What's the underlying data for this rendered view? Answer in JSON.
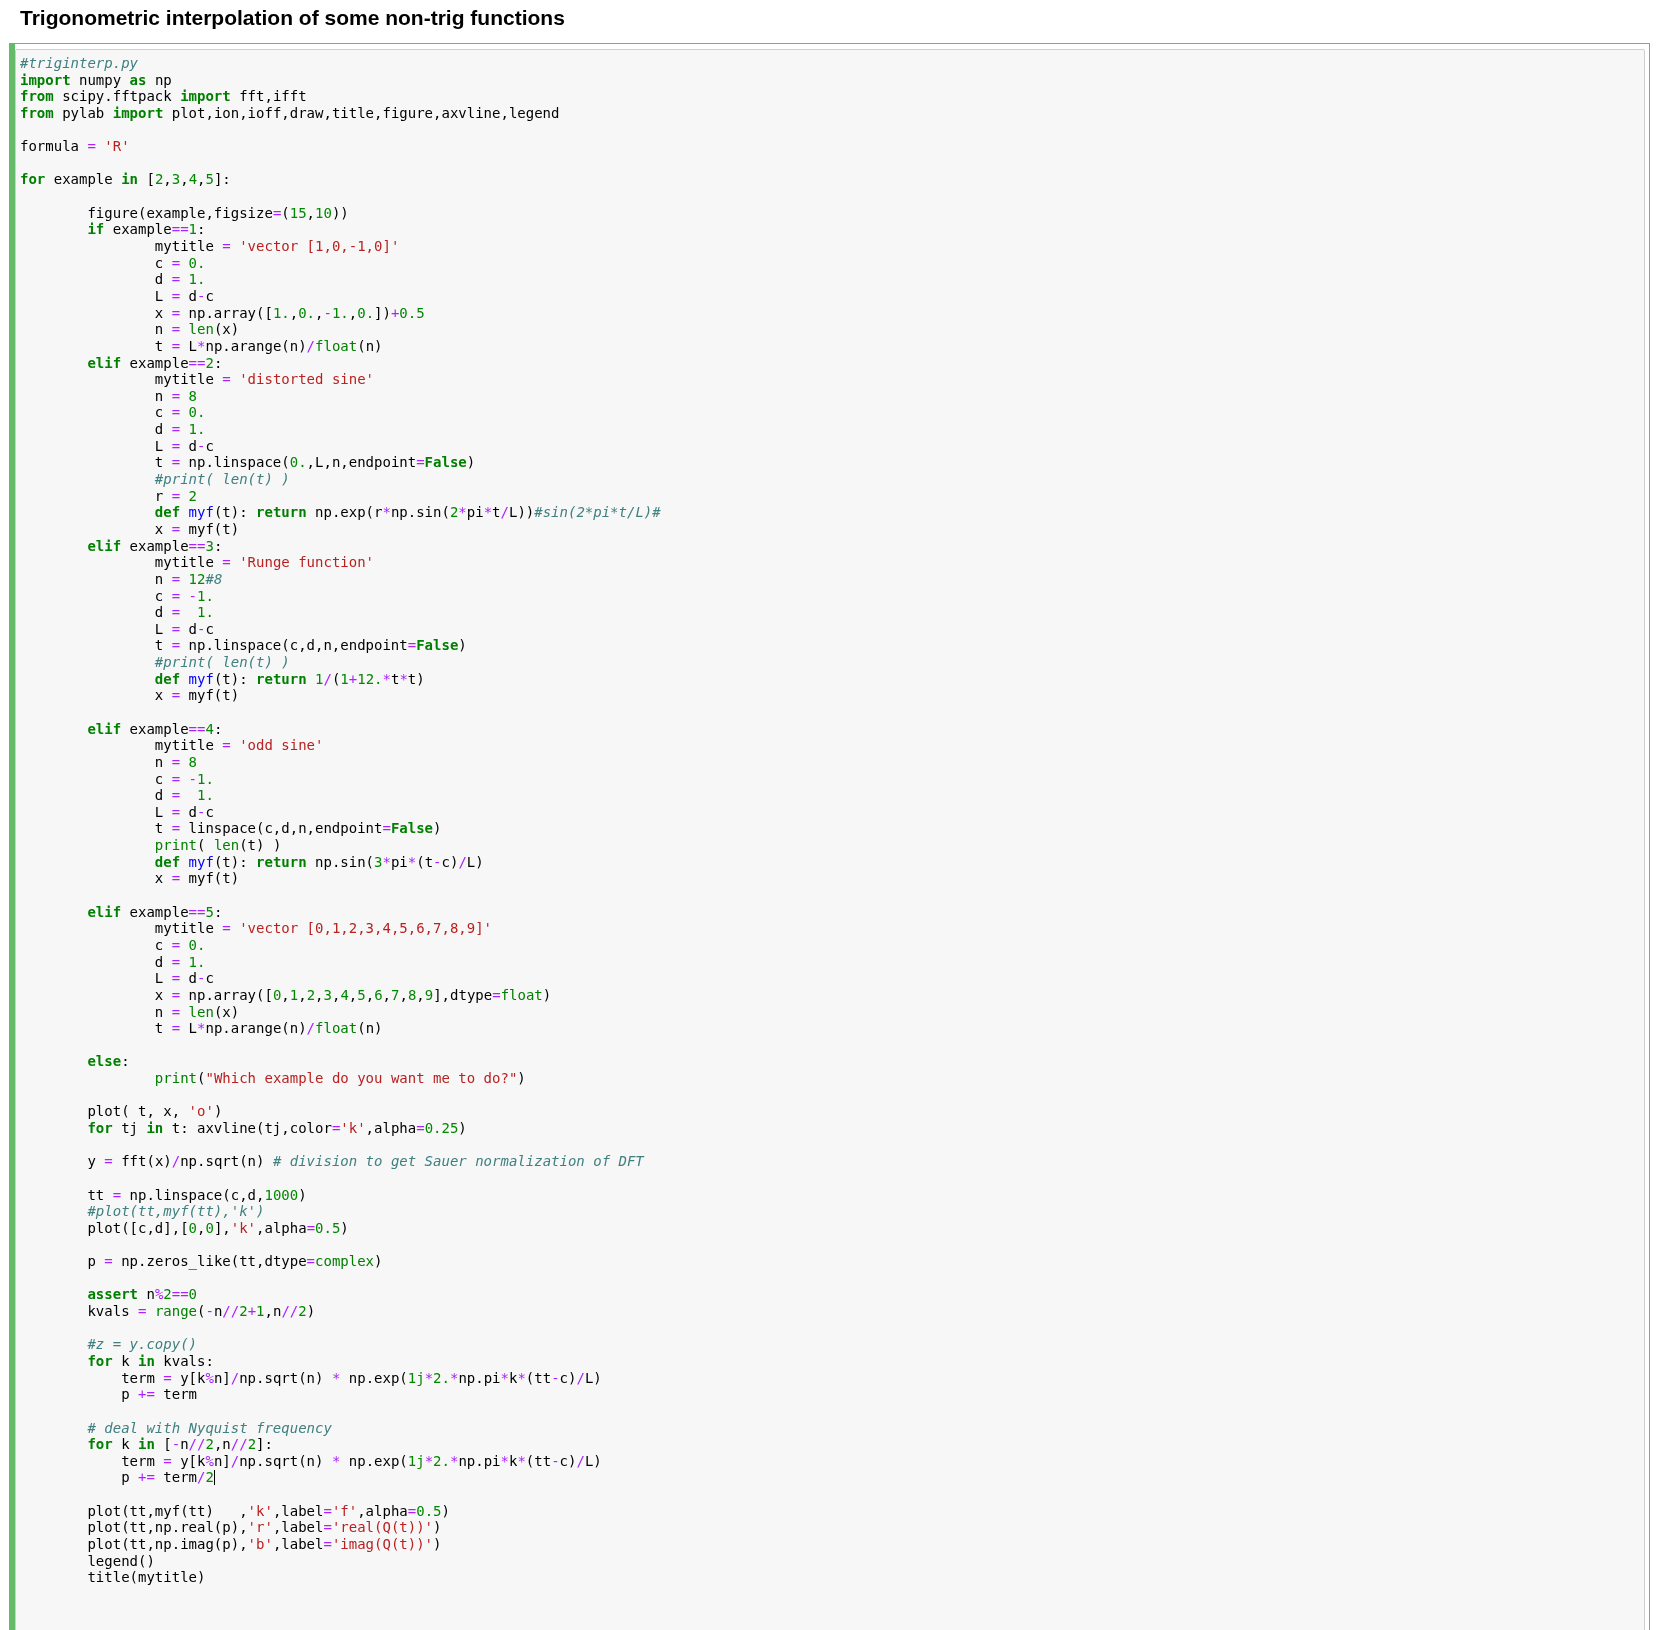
{
  "title": "Trigonometric interpolation of some non-trig functions",
  "code_lines": [
    {
      "tokens": [
        {
          "kind": "c",
          "text": "#triginterp.py"
        }
      ]
    },
    {
      "tokens": [
        {
          "kind": "k",
          "text": "import"
        },
        {
          "kind": "p",
          "text": " numpy "
        },
        {
          "kind": "k",
          "text": "as"
        },
        {
          "kind": "p",
          "text": " np"
        }
      ]
    },
    {
      "tokens": [
        {
          "kind": "k",
          "text": "from"
        },
        {
          "kind": "p",
          "text": " scipy.fftpack "
        },
        {
          "kind": "k",
          "text": "import"
        },
        {
          "kind": "p",
          "text": " fft,ifft"
        }
      ]
    },
    {
      "tokens": [
        {
          "kind": "k",
          "text": "from"
        },
        {
          "kind": "p",
          "text": " pylab "
        },
        {
          "kind": "k",
          "text": "import"
        },
        {
          "kind": "p",
          "text": " plot,ion,ioff,draw,title,figure,axvline,legend"
        }
      ]
    },
    {
      "gap": true,
      "tokens": [
        {
          "kind": "p",
          "text": "formula "
        },
        {
          "kind": "o",
          "text": "="
        },
        {
          "kind": "s",
          "text": " 'R'"
        }
      ]
    },
    {
      "gap": true,
      "tokens": [
        {
          "kind": "k",
          "text": "for"
        },
        {
          "kind": "p",
          "text": " example "
        },
        {
          "kind": "k",
          "text": "in"
        },
        {
          "kind": "p",
          "text": " ["
        },
        {
          "kind": "n",
          "text": "2"
        },
        {
          "kind": "p",
          "text": ","
        },
        {
          "kind": "n",
          "text": "3"
        },
        {
          "kind": "p",
          "text": ","
        },
        {
          "kind": "n",
          "text": "4"
        },
        {
          "kind": "p",
          "text": ","
        },
        {
          "kind": "n",
          "text": "5"
        },
        {
          "kind": "p",
          "text": "]:"
        }
      ]
    },
    {
      "gap": true,
      "tokens": [
        {
          "kind": "p",
          "text": "        figure(example,figsize"
        },
        {
          "kind": "o",
          "text": "="
        },
        {
          "kind": "p",
          "text": "("
        },
        {
          "kind": "n",
          "text": "15"
        },
        {
          "kind": "p",
          "text": ","
        },
        {
          "kind": "n",
          "text": "10"
        },
        {
          "kind": "p",
          "text": "))"
        }
      ]
    },
    {
      "tokens": [
        {
          "kind": "k",
          "text": "        if"
        },
        {
          "kind": "p",
          "text": " example"
        },
        {
          "kind": "o",
          "text": "=="
        },
        {
          "kind": "n",
          "text": "1"
        },
        {
          "kind": "p",
          "text": ":"
        }
      ]
    },
    {
      "tokens": [
        {
          "kind": "p",
          "text": "                mytitle "
        },
        {
          "kind": "o",
          "text": "="
        },
        {
          "kind": "s",
          "text": " 'vector [1,0,-1,0]'"
        }
      ]
    },
    {
      "tokens": [
        {
          "kind": "p",
          "text": "                c "
        },
        {
          "kind": "o",
          "text": "="
        },
        {
          "kind": "n",
          "text": " 0."
        }
      ]
    },
    {
      "tokens": [
        {
          "kind": "p",
          "text": "                d "
        },
        {
          "kind": "o",
          "text": "="
        },
        {
          "kind": "n",
          "text": " 1."
        }
      ]
    },
    {
      "tokens": [
        {
          "kind": "p",
          "text": "                L "
        },
        {
          "kind": "o",
          "text": "="
        },
        {
          "kind": "p",
          "text": " d"
        },
        {
          "kind": "o",
          "text": "-"
        },
        {
          "kind": "p",
          "text": "c"
        }
      ]
    },
    {
      "tokens": [
        {
          "kind": "p",
          "text": "                x "
        },
        {
          "kind": "o",
          "text": "="
        },
        {
          "kind": "p",
          "text": " np.array(["
        },
        {
          "kind": "n",
          "text": "1."
        },
        {
          "kind": "p",
          "text": ","
        },
        {
          "kind": "n",
          "text": "0."
        },
        {
          "kind": "p",
          "text": ","
        },
        {
          "kind": "o",
          "text": "-"
        },
        {
          "kind": "n",
          "text": "1."
        },
        {
          "kind": "p",
          "text": ","
        },
        {
          "kind": "n",
          "text": "0."
        },
        {
          "kind": "p",
          "text": "])"
        },
        {
          "kind": "o",
          "text": "+"
        },
        {
          "kind": "n",
          "text": "0.5"
        }
      ]
    },
    {
      "tokens": [
        {
          "kind": "p",
          "text": "                n "
        },
        {
          "kind": "o",
          "text": "="
        },
        {
          "kind": "b",
          "text": " len"
        },
        {
          "kind": "p",
          "text": "(x)"
        }
      ]
    },
    {
      "tokens": [
        {
          "kind": "p",
          "text": "                t "
        },
        {
          "kind": "o",
          "text": "="
        },
        {
          "kind": "p",
          "text": " L"
        },
        {
          "kind": "o",
          "text": "*"
        },
        {
          "kind": "p",
          "text": "np.arange(n)"
        },
        {
          "kind": "o",
          "text": "/"
        },
        {
          "kind": "b",
          "text": "float"
        },
        {
          "kind": "p",
          "text": "(n)"
        }
      ]
    },
    {
      "tokens": [
        {
          "kind": "k",
          "text": "        elif"
        },
        {
          "kind": "p",
          "text": " example"
        },
        {
          "kind": "o",
          "text": "=="
        },
        {
          "kind": "n",
          "text": "2"
        },
        {
          "kind": "p",
          "text": ":"
        }
      ]
    },
    {
      "tokens": [
        {
          "kind": "p",
          "text": "                mytitle "
        },
        {
          "kind": "o",
          "text": "="
        },
        {
          "kind": "s",
          "text": " 'distorted sine'"
        }
      ]
    },
    {
      "tokens": [
        {
          "kind": "p",
          "text": "                n "
        },
        {
          "kind": "o",
          "text": "="
        },
        {
          "kind": "n",
          "text": " 8"
        }
      ]
    },
    {
      "tokens": [
        {
          "kind": "p",
          "text": "                c "
        },
        {
          "kind": "o",
          "text": "="
        },
        {
          "kind": "n",
          "text": " 0."
        }
      ]
    },
    {
      "tokens": [
        {
          "kind": "p",
          "text": "                d "
        },
        {
          "kind": "o",
          "text": "="
        },
        {
          "kind": "n",
          "text": " 1."
        }
      ]
    },
    {
      "tokens": [
        {
          "kind": "p",
          "text": "                L "
        },
        {
          "kind": "o",
          "text": "="
        },
        {
          "kind": "p",
          "text": " d"
        },
        {
          "kind": "o",
          "text": "-"
        },
        {
          "kind": "p",
          "text": "c"
        }
      ]
    },
    {
      "tokens": [
        {
          "kind": "p",
          "text": "                t "
        },
        {
          "kind": "o",
          "text": "="
        },
        {
          "kind": "p",
          "text": " np.linspace("
        },
        {
          "kind": "n",
          "text": "0."
        },
        {
          "kind": "p",
          "text": ",L,n,endpoint"
        },
        {
          "kind": "o",
          "text": "="
        },
        {
          "kind": "k",
          "text": "False"
        },
        {
          "kind": "p",
          "text": ")"
        }
      ]
    },
    {
      "tokens": [
        {
          "kind": "c",
          "text": "                #print( len(t) )"
        }
      ]
    },
    {
      "tokens": [
        {
          "kind": "p",
          "text": "                r "
        },
        {
          "kind": "o",
          "text": "="
        },
        {
          "kind": "n",
          "text": " 2"
        }
      ]
    },
    {
      "tokens": [
        {
          "kind": "k",
          "text": "                def"
        },
        {
          "kind": "f",
          "text": " myf"
        },
        {
          "kind": "p",
          "text": "(t): "
        },
        {
          "kind": "k",
          "text": "return"
        },
        {
          "kind": "p",
          "text": " np.exp(r"
        },
        {
          "kind": "o",
          "text": "*"
        },
        {
          "kind": "p",
          "text": "np.sin("
        },
        {
          "kind": "n",
          "text": "2"
        },
        {
          "kind": "o",
          "text": "*"
        },
        {
          "kind": "p",
          "text": "pi"
        },
        {
          "kind": "o",
          "text": "*"
        },
        {
          "kind": "p",
          "text": "t"
        },
        {
          "kind": "o",
          "text": "/"
        },
        {
          "kind": "p",
          "text": "L))"
        },
        {
          "kind": "c",
          "text": "#sin(2*pi*t/L)#"
        }
      ]
    },
    {
      "tokens": [
        {
          "kind": "p",
          "text": "                x "
        },
        {
          "kind": "o",
          "text": "="
        },
        {
          "kind": "p",
          "text": " myf(t)"
        }
      ]
    },
    {
      "tokens": [
        {
          "kind": "k",
          "text": "        elif"
        },
        {
          "kind": "p",
          "text": " example"
        },
        {
          "kind": "o",
          "text": "=="
        },
        {
          "kind": "n",
          "text": "3"
        },
        {
          "kind": "p",
          "text": ":"
        }
      ]
    },
    {
      "tokens": [
        {
          "kind": "p",
          "text": "                mytitle "
        },
        {
          "kind": "o",
          "text": "="
        },
        {
          "kind": "s",
          "text": " 'Runge function'"
        }
      ]
    },
    {
      "tokens": [
        {
          "kind": "p",
          "text": "                n "
        },
        {
          "kind": "o",
          "text": "="
        },
        {
          "kind": "n",
          "text": " 12"
        },
        {
          "kind": "c",
          "text": "#8"
        }
      ]
    },
    {
      "tokens": [
        {
          "kind": "p",
          "text": "                c "
        },
        {
          "kind": "o",
          "text": "= -"
        },
        {
          "kind": "n",
          "text": "1."
        }
      ]
    },
    {
      "tokens": [
        {
          "kind": "p",
          "text": "                d "
        },
        {
          "kind": "o",
          "text": "="
        },
        {
          "kind": "n",
          "text": "  1."
        }
      ]
    },
    {
      "tokens": [
        {
          "kind": "p",
          "text": "                L "
        },
        {
          "kind": "o",
          "text": "="
        },
        {
          "kind": "p",
          "text": " d"
        },
        {
          "kind": "o",
          "text": "-"
        },
        {
          "kind": "p",
          "text": "c"
        }
      ]
    },
    {
      "tokens": [
        {
          "kind": "p",
          "text": "                t "
        },
        {
          "kind": "o",
          "text": "="
        },
        {
          "kind": "p",
          "text": " np.linspace(c,d,n,endpoint"
        },
        {
          "kind": "o",
          "text": "="
        },
        {
          "kind": "k",
          "text": "False"
        },
        {
          "kind": "p",
          "text": ")"
        }
      ]
    },
    {
      "tokens": [
        {
          "kind": "c",
          "text": "                #print( len(t) )"
        }
      ]
    },
    {
      "tokens": [
        {
          "kind": "k",
          "text": "                def"
        },
        {
          "kind": "f",
          "text": " myf"
        },
        {
          "kind": "p",
          "text": "(t): "
        },
        {
          "kind": "k",
          "text": "return"
        },
        {
          "kind": "n",
          "text": " 1"
        },
        {
          "kind": "o",
          "text": "/"
        },
        {
          "kind": "p",
          "text": "("
        },
        {
          "kind": "n",
          "text": "1"
        },
        {
          "kind": "o",
          "text": "+"
        },
        {
          "kind": "n",
          "text": "12."
        },
        {
          "kind": "o",
          "text": "*"
        },
        {
          "kind": "p",
          "text": "t"
        },
        {
          "kind": "o",
          "text": "*"
        },
        {
          "kind": "p",
          "text": "t)"
        }
      ]
    },
    {
      "tokens": [
        {
          "kind": "p",
          "text": "                x "
        },
        {
          "kind": "o",
          "text": "="
        },
        {
          "kind": "p",
          "text": " myf(t)"
        }
      ]
    },
    {
      "gap": true,
      "tokens": [
        {
          "kind": "k",
          "text": "        elif"
        },
        {
          "kind": "p",
          "text": " example"
        },
        {
          "kind": "o",
          "text": "=="
        },
        {
          "kind": "n",
          "text": "4"
        },
        {
          "kind": "p",
          "text": ":"
        }
      ]
    },
    {
      "tokens": [
        {
          "kind": "p",
          "text": "                mytitle "
        },
        {
          "kind": "o",
          "text": "="
        },
        {
          "kind": "s",
          "text": " 'odd sine'"
        }
      ]
    },
    {
      "tokens": [
        {
          "kind": "p",
          "text": "                n "
        },
        {
          "kind": "o",
          "text": "="
        },
        {
          "kind": "n",
          "text": " 8"
        }
      ]
    },
    {
      "tokens": [
        {
          "kind": "p",
          "text": "                c "
        },
        {
          "kind": "o",
          "text": "= -"
        },
        {
          "kind": "n",
          "text": "1."
        }
      ]
    },
    {
      "tokens": [
        {
          "kind": "p",
          "text": "                d "
        },
        {
          "kind": "o",
          "text": "="
        },
        {
          "kind": "n",
          "text": "  1."
        }
      ]
    },
    {
      "tokens": [
        {
          "kind": "p",
          "text": "                L "
        },
        {
          "kind": "o",
          "text": "="
        },
        {
          "kind": "p",
          "text": " d"
        },
        {
          "kind": "o",
          "text": "-"
        },
        {
          "kind": "p",
          "text": "c"
        }
      ]
    },
    {
      "tokens": [
        {
          "kind": "p",
          "text": "                t "
        },
        {
          "kind": "o",
          "text": "="
        },
        {
          "kind": "p",
          "text": " linspace(c,d,n,endpoint"
        },
        {
          "kind": "o",
          "text": "="
        },
        {
          "kind": "k",
          "text": "False"
        },
        {
          "kind": "p",
          "text": ")"
        }
      ]
    },
    {
      "tokens": [
        {
          "kind": "b",
          "text": "                print"
        },
        {
          "kind": "p",
          "text": "( "
        },
        {
          "kind": "b",
          "text": "len"
        },
        {
          "kind": "p",
          "text": "(t) )"
        }
      ]
    },
    {
      "tokens": [
        {
          "kind": "k",
          "text": "                def"
        },
        {
          "kind": "f",
          "text": " myf"
        },
        {
          "kind": "p",
          "text": "(t): "
        },
        {
          "kind": "k",
          "text": "return"
        },
        {
          "kind": "p",
          "text": " np.sin("
        },
        {
          "kind": "n",
          "text": "3"
        },
        {
          "kind": "o",
          "text": "*"
        },
        {
          "kind": "p",
          "text": "pi"
        },
        {
          "kind": "o",
          "text": "*"
        },
        {
          "kind": "p",
          "text": "(t"
        },
        {
          "kind": "o",
          "text": "-"
        },
        {
          "kind": "p",
          "text": "c)"
        },
        {
          "kind": "o",
          "text": "/"
        },
        {
          "kind": "p",
          "text": "L)"
        }
      ]
    },
    {
      "tokens": [
        {
          "kind": "p",
          "text": "                x "
        },
        {
          "kind": "o",
          "text": "="
        },
        {
          "kind": "p",
          "text": " myf(t)"
        }
      ]
    },
    {
      "gap": true,
      "tokens": [
        {
          "kind": "k",
          "text": "        elif"
        },
        {
          "kind": "p",
          "text": " example"
        },
        {
          "kind": "o",
          "text": "=="
        },
        {
          "kind": "n",
          "text": "5"
        },
        {
          "kind": "p",
          "text": ":"
        }
      ]
    },
    {
      "tokens": [
        {
          "kind": "p",
          "text": "                mytitle "
        },
        {
          "kind": "o",
          "text": "="
        },
        {
          "kind": "s",
          "text": " 'vector [0,1,2,3,4,5,6,7,8,9]'"
        }
      ]
    },
    {
      "tokens": [
        {
          "kind": "p",
          "text": "                c "
        },
        {
          "kind": "o",
          "text": "="
        },
        {
          "kind": "n",
          "text": " 0."
        }
      ]
    },
    {
      "tokens": [
        {
          "kind": "p",
          "text": "                d "
        },
        {
          "kind": "o",
          "text": "="
        },
        {
          "kind": "n",
          "text": " 1."
        }
      ]
    },
    {
      "tokens": [
        {
          "kind": "p",
          "text": "                L "
        },
        {
          "kind": "o",
          "text": "="
        },
        {
          "kind": "p",
          "text": " d"
        },
        {
          "kind": "o",
          "text": "-"
        },
        {
          "kind": "p",
          "text": "c"
        }
      ]
    },
    {
      "tokens": [
        {
          "kind": "p",
          "text": "                x "
        },
        {
          "kind": "o",
          "text": "="
        },
        {
          "kind": "p",
          "text": " np.array(["
        },
        {
          "kind": "n",
          "text": "0"
        },
        {
          "kind": "p",
          "text": ","
        },
        {
          "kind": "n",
          "text": "1"
        },
        {
          "kind": "p",
          "text": ","
        },
        {
          "kind": "n",
          "text": "2"
        },
        {
          "kind": "p",
          "text": ","
        },
        {
          "kind": "n",
          "text": "3"
        },
        {
          "kind": "p",
          "text": ","
        },
        {
          "kind": "n",
          "text": "4"
        },
        {
          "kind": "p",
          "text": ","
        },
        {
          "kind": "n",
          "text": "5"
        },
        {
          "kind": "p",
          "text": ","
        },
        {
          "kind": "n",
          "text": "6"
        },
        {
          "kind": "p",
          "text": ","
        },
        {
          "kind": "n",
          "text": "7"
        },
        {
          "kind": "p",
          "text": ","
        },
        {
          "kind": "n",
          "text": "8"
        },
        {
          "kind": "p",
          "text": ","
        },
        {
          "kind": "n",
          "text": "9"
        },
        {
          "kind": "p",
          "text": "],dtype"
        },
        {
          "kind": "o",
          "text": "="
        },
        {
          "kind": "b",
          "text": "float"
        },
        {
          "kind": "p",
          "text": ")"
        }
      ]
    },
    {
      "tokens": [
        {
          "kind": "p",
          "text": "                n "
        },
        {
          "kind": "o",
          "text": "="
        },
        {
          "kind": "b",
          "text": " len"
        },
        {
          "kind": "p",
          "text": "(x)"
        }
      ]
    },
    {
      "tokens": [
        {
          "kind": "p",
          "text": "                t "
        },
        {
          "kind": "o",
          "text": "="
        },
        {
          "kind": "p",
          "text": " L"
        },
        {
          "kind": "o",
          "text": "*"
        },
        {
          "kind": "p",
          "text": "np.arange(n)"
        },
        {
          "kind": "o",
          "text": "/"
        },
        {
          "kind": "b",
          "text": "float"
        },
        {
          "kind": "p",
          "text": "(n)"
        }
      ]
    },
    {
      "gap": true,
      "tokens": [
        {
          "kind": "k",
          "text": "        else"
        },
        {
          "kind": "p",
          "text": ":"
        }
      ]
    },
    {
      "tokens": [
        {
          "kind": "b",
          "text": "                print"
        },
        {
          "kind": "p",
          "text": "("
        },
        {
          "kind": "s",
          "text": "\"Which example do you want me to do?\""
        },
        {
          "kind": "p",
          "text": ")"
        }
      ]
    },
    {
      "gap": true,
      "tokens": [
        {
          "kind": "p",
          "text": "        plot( t, x, "
        },
        {
          "kind": "s",
          "text": "'o'"
        },
        {
          "kind": "p",
          "text": ")"
        }
      ]
    },
    {
      "tokens": [
        {
          "kind": "k",
          "text": "        for"
        },
        {
          "kind": "p",
          "text": " tj "
        },
        {
          "kind": "k",
          "text": "in"
        },
        {
          "kind": "p",
          "text": " t: axvline(tj,color"
        },
        {
          "kind": "o",
          "text": "="
        },
        {
          "kind": "s",
          "text": "'k'"
        },
        {
          "kind": "p",
          "text": ",alpha"
        },
        {
          "kind": "o",
          "text": "="
        },
        {
          "kind": "n",
          "text": "0.25"
        },
        {
          "kind": "p",
          "text": ")"
        }
      ]
    },
    {
      "gap": true,
      "tokens": [
        {
          "kind": "p",
          "text": "        y "
        },
        {
          "kind": "o",
          "text": "="
        },
        {
          "kind": "p",
          "text": " fft(x)"
        },
        {
          "kind": "o",
          "text": "/"
        },
        {
          "kind": "p",
          "text": "np.sqrt(n) "
        },
        {
          "kind": "c",
          "text": "# division to get Sauer normalization of DFT"
        }
      ]
    },
    {
      "gap": true,
      "tokens": [
        {
          "kind": "p",
          "text": "        tt "
        },
        {
          "kind": "o",
          "text": "="
        },
        {
          "kind": "p",
          "text": " np.linspace(c,d,"
        },
        {
          "kind": "n",
          "text": "1000"
        },
        {
          "kind": "p",
          "text": ")"
        }
      ]
    },
    {
      "tokens": [
        {
          "kind": "c",
          "text": "        #plot(tt,myf(tt),'k')"
        }
      ]
    },
    {
      "tokens": [
        {
          "kind": "p",
          "text": "        plot([c,d],["
        },
        {
          "kind": "n",
          "text": "0"
        },
        {
          "kind": "p",
          "text": ","
        },
        {
          "kind": "n",
          "text": "0"
        },
        {
          "kind": "p",
          "text": "],"
        },
        {
          "kind": "s",
          "text": "'k'"
        },
        {
          "kind": "p",
          "text": ",alpha"
        },
        {
          "kind": "o",
          "text": "="
        },
        {
          "kind": "n",
          "text": "0.5"
        },
        {
          "kind": "p",
          "text": ")"
        }
      ]
    },
    {
      "gap": true,
      "tokens": [
        {
          "kind": "p",
          "text": "        p "
        },
        {
          "kind": "o",
          "text": "="
        },
        {
          "kind": "p",
          "text": " np.zeros_like(tt,dtype"
        },
        {
          "kind": "o",
          "text": "="
        },
        {
          "kind": "b",
          "text": "complex"
        },
        {
          "kind": "p",
          "text": ")"
        }
      ]
    },
    {
      "gap": true,
      "tokens": [
        {
          "kind": "k",
          "text": "        assert"
        },
        {
          "kind": "p",
          "text": " n"
        },
        {
          "kind": "o",
          "text": "%"
        },
        {
          "kind": "n",
          "text": "2"
        },
        {
          "kind": "o",
          "text": "=="
        },
        {
          "kind": "n",
          "text": "0"
        }
      ]
    },
    {
      "tokens": [
        {
          "kind": "p",
          "text": "        kvals "
        },
        {
          "kind": "o",
          "text": "="
        },
        {
          "kind": "b",
          "text": " range"
        },
        {
          "kind": "p",
          "text": "("
        },
        {
          "kind": "o",
          "text": "-"
        },
        {
          "kind": "p",
          "text": "n"
        },
        {
          "kind": "o",
          "text": "//"
        },
        {
          "kind": "n",
          "text": "2"
        },
        {
          "kind": "o",
          "text": "+"
        },
        {
          "kind": "n",
          "text": "1"
        },
        {
          "kind": "p",
          "text": ",n"
        },
        {
          "kind": "o",
          "text": "//"
        },
        {
          "kind": "n",
          "text": "2"
        },
        {
          "kind": "p",
          "text": ")"
        }
      ]
    },
    {
      "gap": true,
      "tokens": [
        {
          "kind": "c",
          "text": "        #z = y.copy()"
        }
      ]
    },
    {
      "tokens": [
        {
          "kind": "k",
          "text": "        for"
        },
        {
          "kind": "p",
          "text": " k "
        },
        {
          "kind": "k",
          "text": "in"
        },
        {
          "kind": "p",
          "text": " kvals:"
        }
      ]
    },
    {
      "tokens": [
        {
          "kind": "p",
          "text": "            term "
        },
        {
          "kind": "o",
          "text": "="
        },
        {
          "kind": "p",
          "text": " y[k"
        },
        {
          "kind": "o",
          "text": "%"
        },
        {
          "kind": "p",
          "text": "n]"
        },
        {
          "kind": "o",
          "text": "/"
        },
        {
          "kind": "p",
          "text": "np.sqrt(n) "
        },
        {
          "kind": "o",
          "text": "*"
        },
        {
          "kind": "p",
          "text": " np.exp("
        },
        {
          "kind": "n",
          "text": "1j"
        },
        {
          "kind": "o",
          "text": "*"
        },
        {
          "kind": "n",
          "text": "2."
        },
        {
          "kind": "o",
          "text": "*"
        },
        {
          "kind": "p",
          "text": "np.pi"
        },
        {
          "kind": "o",
          "text": "*"
        },
        {
          "kind": "p",
          "text": "k"
        },
        {
          "kind": "o",
          "text": "*"
        },
        {
          "kind": "p",
          "text": "(tt"
        },
        {
          "kind": "o",
          "text": "-"
        },
        {
          "kind": "p",
          "text": "c)"
        },
        {
          "kind": "o",
          "text": "/"
        },
        {
          "kind": "p",
          "text": "L)"
        }
      ]
    },
    {
      "tokens": [
        {
          "kind": "p",
          "text": "            p "
        },
        {
          "kind": "o",
          "text": "+="
        },
        {
          "kind": "p",
          "text": " term"
        }
      ]
    },
    {
      "gap": true,
      "tokens": [
        {
          "kind": "c",
          "text": "        # deal with Nyquist frequency"
        }
      ]
    },
    {
      "tokens": [
        {
          "kind": "k",
          "text": "        for"
        },
        {
          "kind": "p",
          "text": " k "
        },
        {
          "kind": "k",
          "text": "in"
        },
        {
          "kind": "p",
          "text": " ["
        },
        {
          "kind": "o",
          "text": "-"
        },
        {
          "kind": "p",
          "text": "n"
        },
        {
          "kind": "o",
          "text": "//"
        },
        {
          "kind": "n",
          "text": "2"
        },
        {
          "kind": "p",
          "text": ",n"
        },
        {
          "kind": "o",
          "text": "//"
        },
        {
          "kind": "n",
          "text": "2"
        },
        {
          "kind": "p",
          "text": "]:"
        }
      ]
    },
    {
      "tokens": [
        {
          "kind": "p",
          "text": "            term "
        },
        {
          "kind": "o",
          "text": "="
        },
        {
          "kind": "p",
          "text": " y[k"
        },
        {
          "kind": "o",
          "text": "%"
        },
        {
          "kind": "p",
          "text": "n]"
        },
        {
          "kind": "o",
          "text": "/"
        },
        {
          "kind": "p",
          "text": "np.sqrt(n) "
        },
        {
          "kind": "o",
          "text": "*"
        },
        {
          "kind": "p",
          "text": " np.exp("
        },
        {
          "kind": "n",
          "text": "1j"
        },
        {
          "kind": "o",
          "text": "*"
        },
        {
          "kind": "n",
          "text": "2."
        },
        {
          "kind": "o",
          "text": "*"
        },
        {
          "kind": "p",
          "text": "np.pi"
        },
        {
          "kind": "o",
          "text": "*"
        },
        {
          "kind": "p",
          "text": "k"
        },
        {
          "kind": "o",
          "text": "*"
        },
        {
          "kind": "p",
          "text": "(tt"
        },
        {
          "kind": "o",
          "text": "-"
        },
        {
          "kind": "p",
          "text": "c)"
        },
        {
          "kind": "o",
          "text": "/"
        },
        {
          "kind": "p",
          "text": "L)"
        }
      ]
    },
    {
      "cursor": true,
      "tokens": [
        {
          "kind": "p",
          "text": "            p "
        },
        {
          "kind": "o",
          "text": "+="
        },
        {
          "kind": "p",
          "text": " term"
        },
        {
          "kind": "o",
          "text": "/"
        },
        {
          "kind": "n",
          "text": "2"
        }
      ]
    },
    {
      "gap": true,
      "tokens": [
        {
          "kind": "p",
          "text": "        plot(tt,myf(tt)   ,"
        },
        {
          "kind": "s",
          "text": "'k'"
        },
        {
          "kind": "p",
          "text": ",label"
        },
        {
          "kind": "o",
          "text": "="
        },
        {
          "kind": "s",
          "text": "'f'"
        },
        {
          "kind": "p",
          "text": ",alpha"
        },
        {
          "kind": "o",
          "text": "="
        },
        {
          "kind": "n",
          "text": "0.5"
        },
        {
          "kind": "p",
          "text": ")"
        }
      ]
    },
    {
      "tokens": [
        {
          "kind": "p",
          "text": "        plot(tt,np.real(p),"
        },
        {
          "kind": "s",
          "text": "'r'"
        },
        {
          "kind": "p",
          "text": ",label"
        },
        {
          "kind": "o",
          "text": "="
        },
        {
          "kind": "s",
          "text": "'real(Q(t))'"
        },
        {
          "kind": "p",
          "text": ")"
        }
      ]
    },
    {
      "tokens": [
        {
          "kind": "p",
          "text": "        plot(tt,np.imag(p),"
        },
        {
          "kind": "s",
          "text": "'b'"
        },
        {
          "kind": "p",
          "text": ",label"
        },
        {
          "kind": "o",
          "text": "="
        },
        {
          "kind": "s",
          "text": "'imag(Q(t))'"
        },
        {
          "kind": "p",
          "text": ")"
        }
      ]
    },
    {
      "tokens": [
        {
          "kind": "p",
          "text": "        legend()"
        }
      ]
    },
    {
      "tokens": [
        {
          "kind": "p",
          "text": "        title(mytitle)"
        }
      ]
    }
  ]
}
